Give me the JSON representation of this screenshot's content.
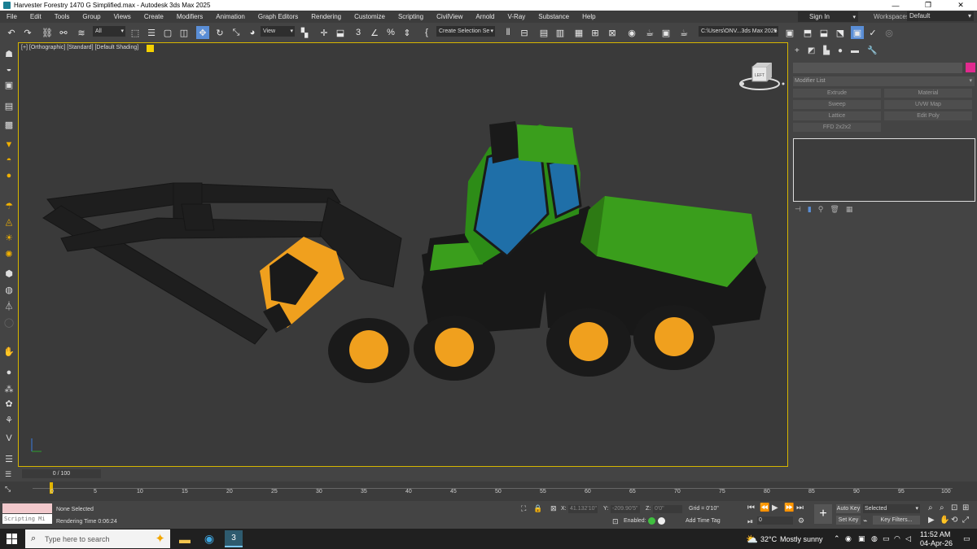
{
  "window": {
    "title": "Harvester Forestry 1470 G Simplified.max - Autodesk 3ds Max 2025",
    "controls": [
      "—",
      "❐",
      "✕"
    ]
  },
  "menu": [
    "File",
    "Edit",
    "Tools",
    "Group",
    "Views",
    "Create",
    "Modifiers",
    "Animation",
    "Graph Editors",
    "Rendering",
    "Customize",
    "Scripting",
    "CivilView",
    "Arnold",
    "V-Ray",
    "Substance",
    "Help"
  ],
  "account": {
    "signin": "Sign In",
    "workspaces_label": "Workspaces:",
    "workspace": "Default"
  },
  "toolbar": {
    "selection_filter": "All",
    "ref_coord": "View",
    "named_selection": "Create Selection Se",
    "project_path": "C:\\Users\\ONV...3ds Max 2025"
  },
  "viewport": {
    "label": "[+] [Orthographic] [Standard] [Default Shading]",
    "viewcube_face": "LEFT"
  },
  "command_panel": {
    "modifier_list": "Modifier List",
    "modifier_buttons": [
      "Extrude",
      "Material",
      "Sweep",
      "UVW Map",
      "Lattice",
      "Edit Poly",
      "FFD 2x2x2"
    ]
  },
  "time": {
    "slider": "0 / 100",
    "ticks": [
      "0",
      "5",
      "10",
      "15",
      "20",
      "25",
      "30",
      "35",
      "40",
      "45",
      "50",
      "55",
      "60",
      "65",
      "70",
      "75",
      "80",
      "85",
      "90",
      "95",
      "100"
    ]
  },
  "status": {
    "selection": "None Selected",
    "render_time": "Rendering Time  0:06:24",
    "script_label": "Scripting Mi",
    "x_label": "X:",
    "x_val": "41.132'10\"",
    "y_label": "Y:",
    "y_val": "-209.90'5\"",
    "z_label": "Z:",
    "z_val": "0'0\"",
    "grid": "Grid = 0'10\"",
    "enabled": "Enabled:",
    "add_time_tag": "Add Time Tag",
    "frame": "0",
    "auto_key": "Auto Key",
    "set_key": "Set Key",
    "key_mode": "Selected",
    "key_filters": "Key Filters..."
  },
  "taskbar": {
    "search_placeholder": "Type here to search",
    "weather_temp": "32°C",
    "weather_desc": "Mostly sunny",
    "time": "11:52 AM",
    "date": "04-Apr-26"
  },
  "colors": {
    "viewport_border": "#d6b500",
    "machine_green": "#3a9e1c",
    "wheel_orange": "#f0a01e",
    "glass_blue": "#1f6fa8"
  }
}
